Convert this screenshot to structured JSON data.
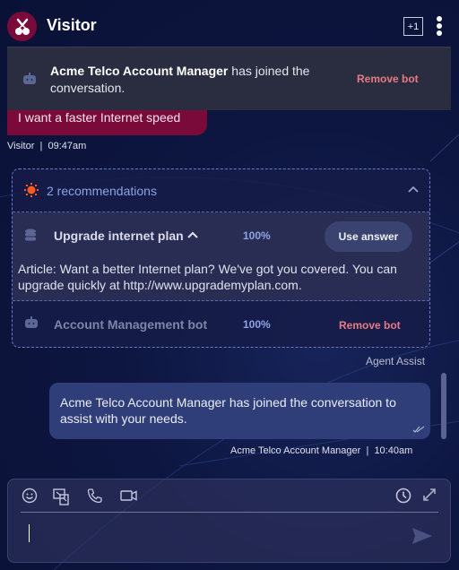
{
  "header": {
    "title": "Visitor",
    "participants_badge": "+1",
    "avatar_icon": "cherry-icon",
    "menu_icon": "kebab-menu-icon"
  },
  "toast": {
    "icon": "bot-icon",
    "name": "Acme Telco Account Manager",
    "message": " has joined the conversation.",
    "action_label": "Remove bot"
  },
  "messages": [
    {
      "sender": "Visitor",
      "text": "I want a faster Internet speed",
      "meta_sender": "Visitor",
      "meta_separator": "|",
      "time": "09:47am",
      "color": "#7a0a3a"
    },
    {
      "sender": "Acme Telco Account Manager",
      "text": "Acme Telco Account Manager has joined the conversation to assist with your needs.",
      "meta_sender": "Acme Telco Account Manager",
      "meta_separator": "|",
      "time": "10:40am",
      "status_icon": "double-check-icon",
      "color": "#2f3d78"
    }
  ],
  "recommendations": {
    "icon": "sun-icon",
    "count_label": "2 recommendations",
    "items": [
      {
        "icon": "database-icon",
        "title": "Upgrade internet plan",
        "score": "100%",
        "action_label": "Use answer",
        "expanded": true,
        "article": "Article: Want a better Internet plan? We've got you covered. You can upgrade quickly at http://www.upgrademyplan.com."
      },
      {
        "icon": "bot-icon",
        "title": "Account Management bot",
        "score": "100%",
        "action_label": "Remove bot"
      }
    ],
    "footer_label": "Agent Assist"
  },
  "composer": {
    "tools": [
      "emoji-icon",
      "screen-share-icon",
      "phone-icon",
      "video-icon"
    ],
    "right_tools": [
      "clock-icon",
      "expand-icon"
    ],
    "input_value": "",
    "placeholder": "",
    "send_icon": "send-icon"
  },
  "colors": {
    "accent": "#7a0a3a",
    "remove": "#e87a84",
    "score": "#8ea2e6",
    "recommendation_icon": "#ff5a1f"
  }
}
